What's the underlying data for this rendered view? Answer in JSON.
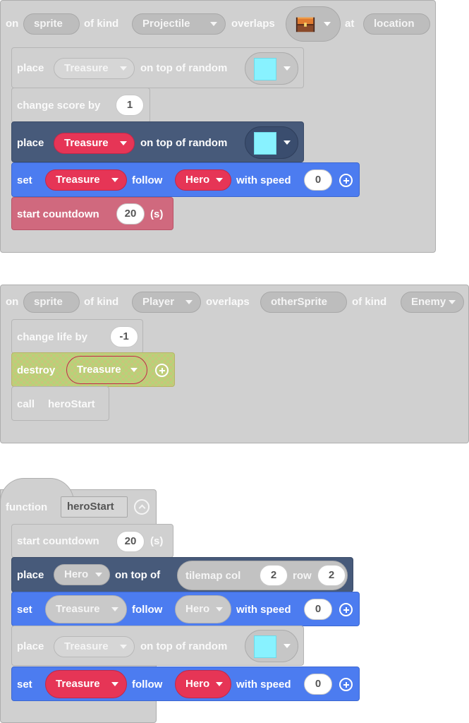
{
  "events": [
    {
      "on": "on",
      "sprite_var": "sprite",
      "of_kind": "of kind",
      "kind": "Projectile",
      "overlaps": "overlaps",
      "tile_icon": "treasure-chest-icon",
      "at": "at",
      "location_var": "location",
      "blocks": [
        {
          "kw": "place",
          "sprite": "Treasure",
          "rest": "on top of random",
          "color": "#88f2ff"
        },
        {
          "kw": "change score by",
          "value": "1"
        },
        {
          "kw": "place",
          "sprite": "Treasure",
          "rest": "on top of random",
          "color": "#88f2ff"
        },
        {
          "kw": "set",
          "sprite": "Treasure",
          "follow": "follow",
          "target": "Hero",
          "with_speed": "with speed",
          "value": "0"
        },
        {
          "kw": "start countdown",
          "value": "20",
          "unit": "(s)"
        }
      ]
    },
    {
      "on": "on",
      "sprite_var": "sprite",
      "of_kind": "of kind",
      "kind": "Player",
      "overlaps": "overlaps",
      "other_var": "otherSprite",
      "of_kind2": "of kind",
      "kind2": "Enemy",
      "blocks": [
        {
          "kw": "change life by",
          "value": "-1"
        },
        {
          "kw": "destroy",
          "sprite": "Treasure"
        },
        {
          "kw": "call",
          "fn": "heroStart"
        }
      ]
    }
  ],
  "function": {
    "kw": "function",
    "name": "heroStart",
    "blocks": [
      {
        "kw": "start countdown",
        "value": "20",
        "unit": "(s)"
      },
      {
        "kw": "place",
        "sprite": "Hero",
        "rest": "on top of",
        "tilemap": "tilemap col",
        "col": "2",
        "row_kw": "row",
        "row": "2"
      },
      {
        "kw": "set",
        "sprite": "Treasure",
        "follow": "follow",
        "target": "Hero",
        "with_speed": "with speed",
        "value": "0"
      },
      {
        "kw": "place",
        "sprite": "Treasure",
        "rest": "on top of random",
        "color": "#88f2ff"
      },
      {
        "kw": "set",
        "sprite": "Treasure",
        "follow": "follow",
        "target": "Hero",
        "with_speed": "with speed",
        "value": "0"
      }
    ]
  }
}
